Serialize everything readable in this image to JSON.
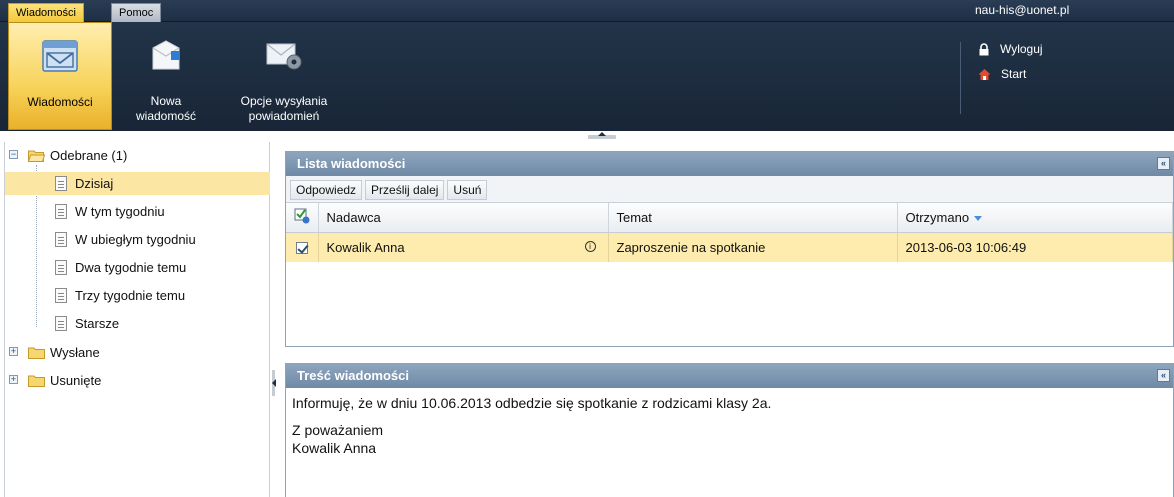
{
  "topbar": {
    "tabs": [
      {
        "label": "Wiadomości"
      },
      {
        "label": "Pomoc"
      }
    ],
    "user_email": "nau-his@uonet.pl"
  },
  "ribbon": {
    "buttons": [
      {
        "label_line1": "Wiadomości",
        "label_line2": ""
      },
      {
        "label_line1": "Nowa",
        "label_line2": "wiadomość"
      },
      {
        "label_line1": "Opcje wysyłania",
        "label_line2": "powiadomień"
      }
    ],
    "logout_label": "Wyloguj",
    "start_label": "Start"
  },
  "tree": {
    "inbox": "Odebrane (1)",
    "inbox_children": [
      "Dzisiaj",
      "W tym tygodniu",
      "W ubiegłym tygodniu",
      "Dwa tygodnie temu",
      "Trzy tygodnie temu",
      "Starsze"
    ],
    "sent": "Wysłane",
    "deleted": "Usunięte"
  },
  "list_panel": {
    "title": "Lista wiadomości",
    "toolbar": {
      "reply": "Odpowiedz",
      "forward": "Prześlij dalej",
      "delete": "Usuń"
    },
    "columns": {
      "sender": "Nadawca",
      "subject": "Temat",
      "received": "Otrzymano"
    },
    "rows": [
      {
        "sender": "Kowalik Anna",
        "subject": "Zaproszenie na spotkanie",
        "received": "2013-06-03 10:06:49",
        "checked": true
      }
    ]
  },
  "body_panel": {
    "title": "Treść wiadomości",
    "line1": "Informuję, że w dniu 10.06.2013 odbedzie się spotkanie z rodzicami klasy 2a.",
    "line2": "Z poważaniem",
    "line3": "Kowalik Anna"
  },
  "colors": {
    "accent": "#f3c93b",
    "header_bg": "#1e2f45",
    "selection": "#fdecad",
    "panel_head": "#7a93ae"
  }
}
